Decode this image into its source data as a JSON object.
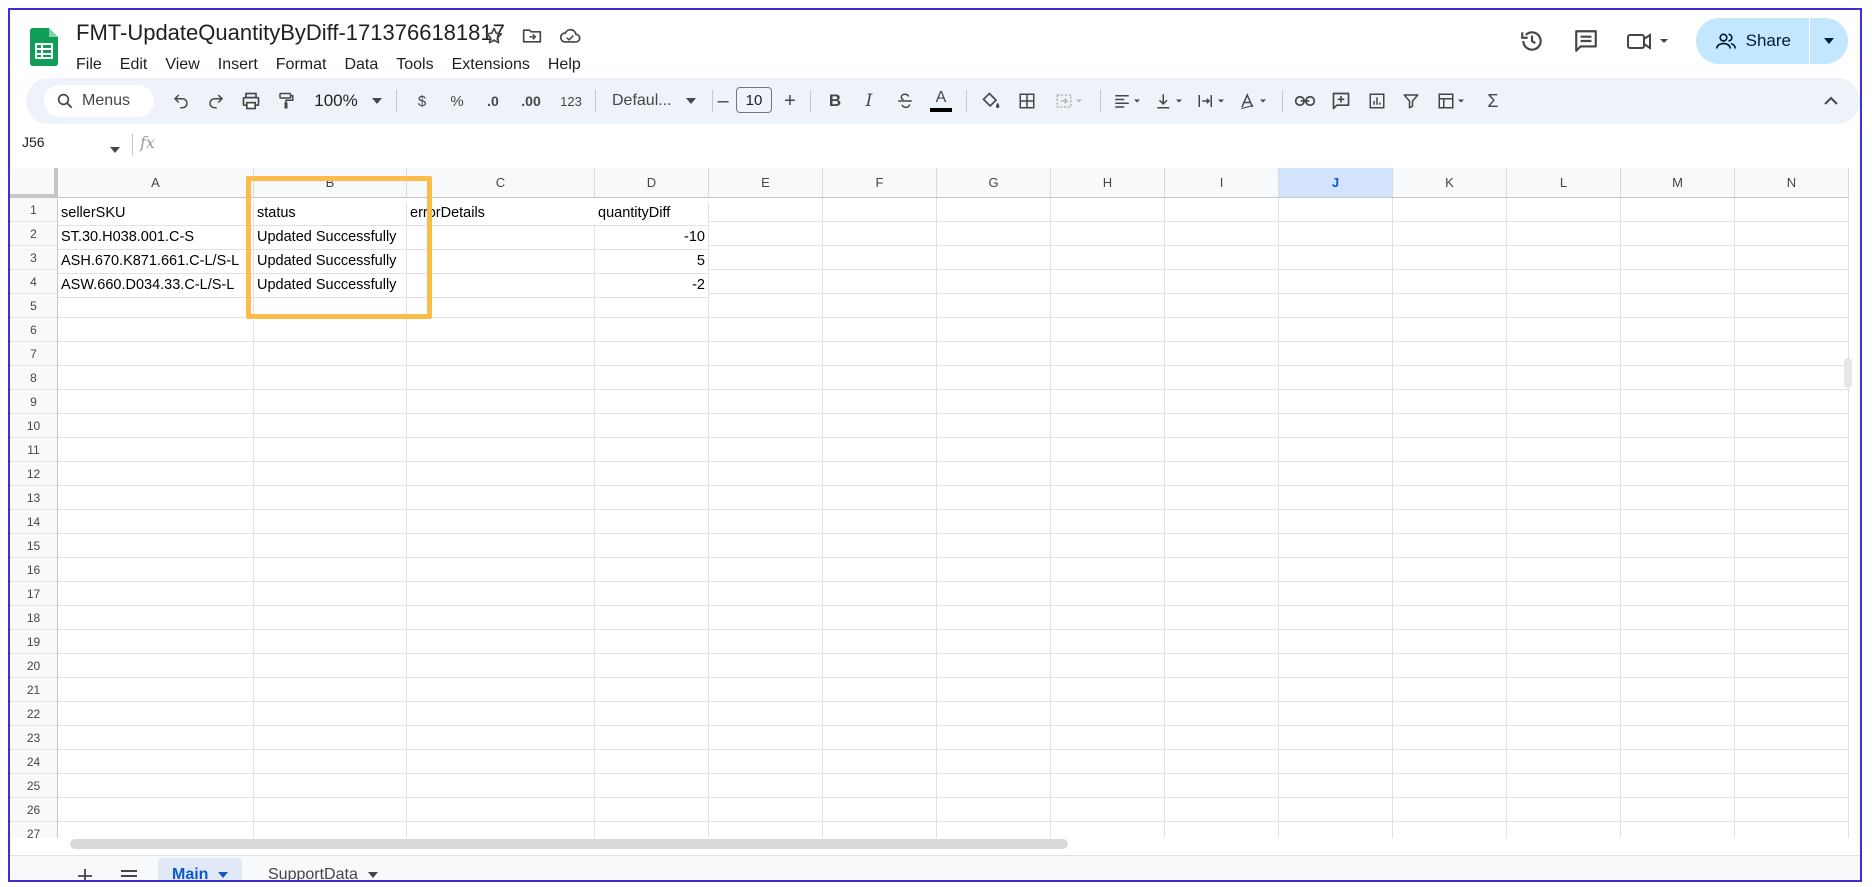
{
  "app": {
    "doc_title": "FMT-UpdateQuantityByDiff-1713766181817",
    "menu": [
      "File",
      "Edit",
      "View",
      "Insert",
      "Format",
      "Data",
      "Tools",
      "Extensions",
      "Help"
    ],
    "share_label": "Share"
  },
  "toolbar": {
    "search_label": "Menus",
    "zoom": "100%",
    "currency": "$",
    "percent": "%",
    "dec_decrease": ".0",
    "dec_increase": ".00",
    "number_format": "123",
    "font": "Defaul...",
    "font_size": "10",
    "bold": "B",
    "italic": "I",
    "text_color": "A",
    "sigma": "Σ"
  },
  "formula_bar": {
    "name_box": "J56",
    "fx": "fx"
  },
  "grid": {
    "columns": [
      "A",
      "B",
      "C",
      "D",
      "E",
      "F",
      "G",
      "H",
      "I",
      "J",
      "K",
      "L",
      "M",
      "N"
    ],
    "selected_column": "J",
    "rows": [
      "1",
      "2",
      "3",
      "4",
      "5",
      "6",
      "7",
      "8",
      "9",
      "10",
      "11",
      "12",
      "13",
      "14",
      "15",
      "16",
      "17",
      "18",
      "19",
      "20",
      "21",
      "22",
      "23",
      "24",
      "25",
      "26",
      "27"
    ],
    "headers": [
      "sellerSKU",
      "status",
      "errorDetails",
      "quantityDiff"
    ],
    "data": [
      {
        "sku": "ST.30.H038.001.C-S",
        "status": "Updated Successfully",
        "error": "",
        "diff": "-10"
      },
      {
        "sku": "ASH.670.K871.661.C-L/S-L",
        "status": "Updated Successfully",
        "error": "",
        "diff": "5"
      },
      {
        "sku": "ASW.660.D034.33.C-L/S-L",
        "status": "Updated Successfully",
        "error": "",
        "diff": "-2"
      }
    ]
  },
  "sheets": {
    "tabs": [
      {
        "label": "Main",
        "active": true
      },
      {
        "label": "SupportData",
        "active": false
      }
    ]
  },
  "colors": {
    "accent": "#0b57d0",
    "share_bg": "#c2e7ff",
    "highlight": "#fbbc4b",
    "sheets_green": "#0f9d58"
  }
}
